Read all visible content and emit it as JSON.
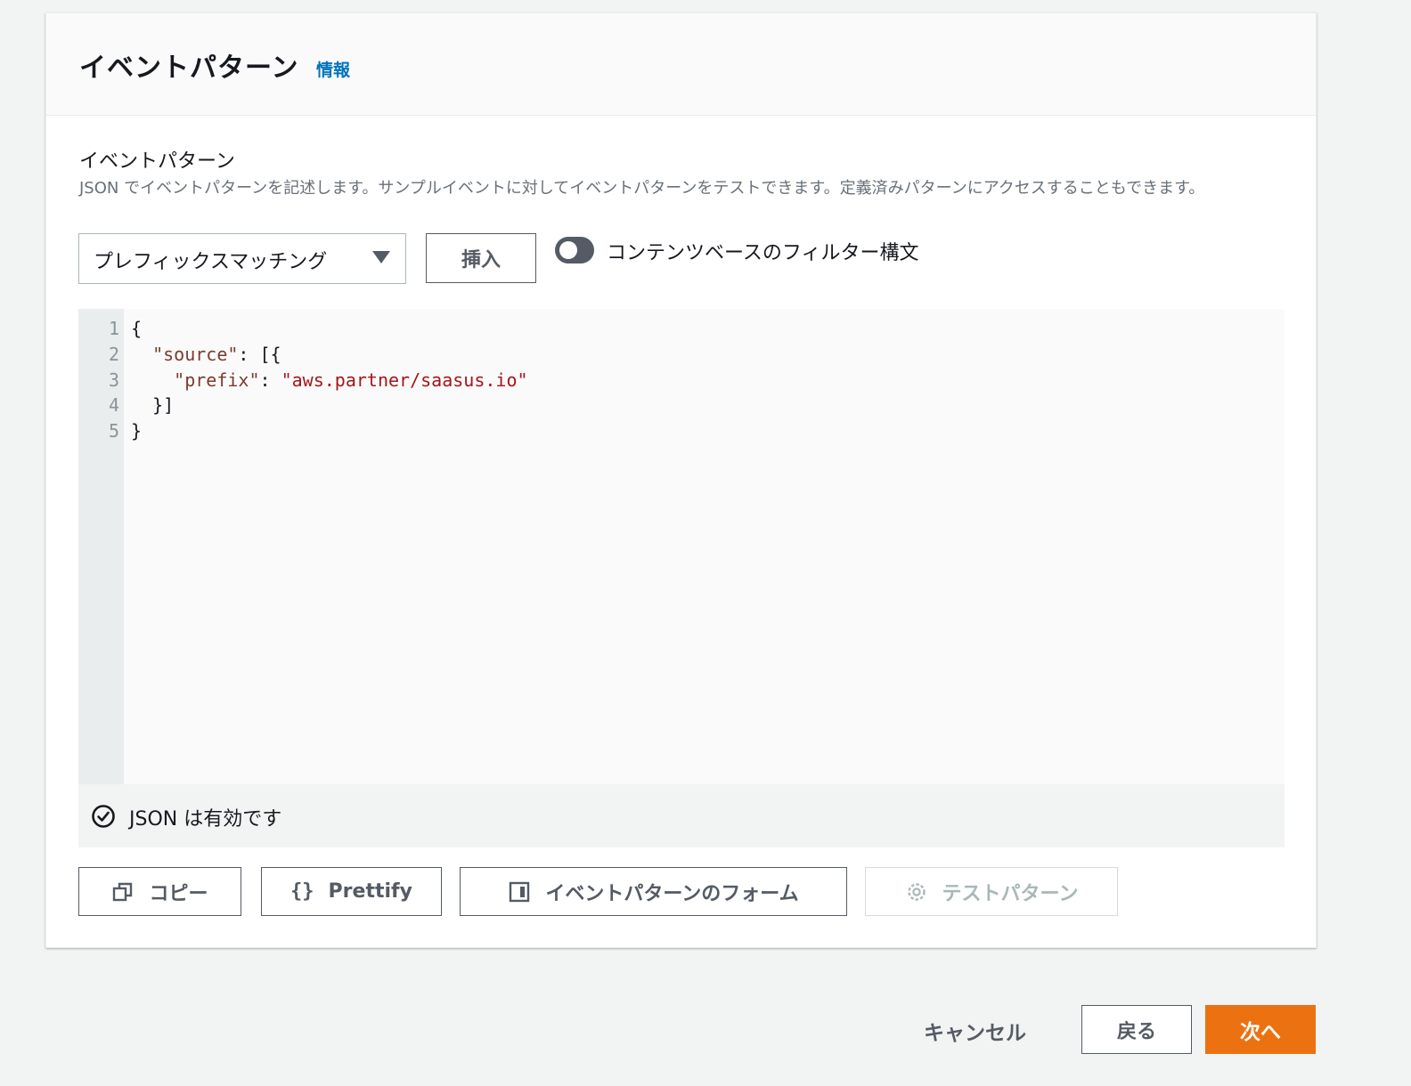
{
  "panel": {
    "title": "イベントパターン",
    "info_link": "情報"
  },
  "field": {
    "label": "イベントパターン",
    "description": "JSON でイベントパターンを記述します。サンプルイベントに対してイベントパターンをテストできます。定義済みパターンにアクセスすることもできます。"
  },
  "controls": {
    "select_value": "プレフィックスマッチング",
    "insert_label": "挿入",
    "toggle_label": "コンテンツベースのフィルター構文",
    "toggle_on": false
  },
  "editor": {
    "line_numbers": [
      "1",
      "2",
      "3",
      "4",
      "5"
    ],
    "lines": [
      {
        "indent": "",
        "key": "",
        "sep": "",
        "value": "",
        "text": "{"
      },
      {
        "indent": "  ",
        "key": "\"source\"",
        "sep": ": ",
        "value": "",
        "text": "[{"
      },
      {
        "indent": "    ",
        "key": "\"prefix\"",
        "sep": ": ",
        "value": "\"aws.partner/saasus.io\"",
        "text": ""
      },
      {
        "indent": "  ",
        "key": "",
        "sep": "",
        "value": "",
        "text": "}]"
      },
      {
        "indent": "",
        "key": "",
        "sep": "",
        "value": "",
        "text": "}"
      }
    ],
    "status_text": "JSON は有効です"
  },
  "actions": {
    "copy_label": "コピー",
    "prettify_glyph": "{}",
    "prettify_label": "Prettify",
    "form_label": "イベントパターンのフォーム",
    "test_label": "テストパターン"
  },
  "footer": {
    "cancel_label": "キャンセル",
    "back_label": "戻る",
    "next_label": "次へ"
  },
  "colors": {
    "accent": "#ec7211",
    "link": "#0073bb",
    "key": "#7a3b2e",
    "string": "#a4161a"
  },
  "icons": [
    "chevron-down-icon",
    "check-circle-icon",
    "copy-icon",
    "braces-icon",
    "form-icon",
    "gear-icon"
  ]
}
